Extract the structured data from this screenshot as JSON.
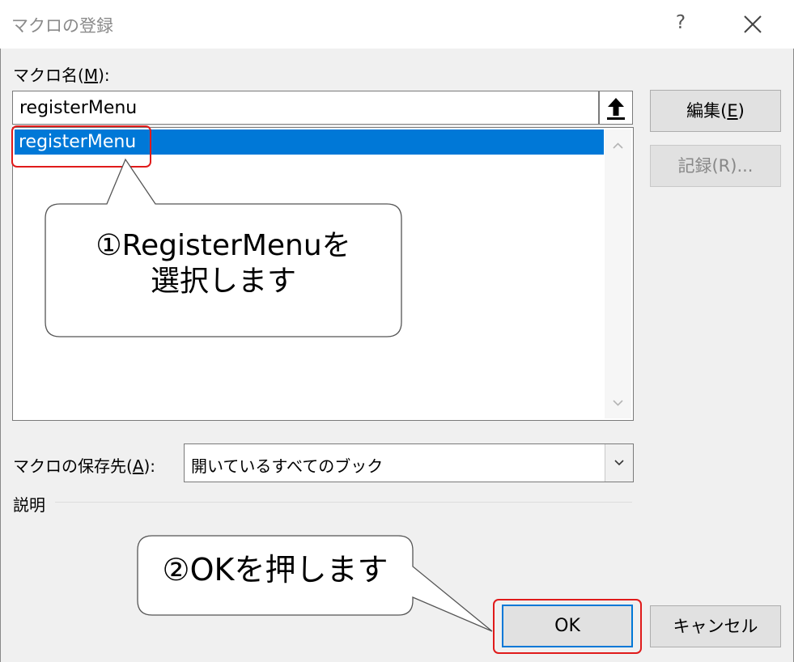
{
  "dialog": {
    "title": "マクロの登録",
    "help_label": "?"
  },
  "macro_name": {
    "label_prefix": "マクロ名(",
    "label_accel": "M",
    "label_suffix": "):",
    "value": "registerMenu"
  },
  "macro_list": {
    "items": [
      {
        "label": "registerMenu",
        "selected": true
      }
    ]
  },
  "buttons": {
    "edit_prefix": "編集(",
    "edit_accel": "E",
    "edit_suffix": ")",
    "record": "記録(R)...",
    "ok": "OK",
    "cancel": "キャンセル"
  },
  "save_in": {
    "label_prefix": "マクロの保存先(",
    "label_accel": "A",
    "label_suffix": "):",
    "value": "開いているすべてのブック"
  },
  "description": {
    "label": "説明"
  },
  "annotations": {
    "callout1_line1": "①RegisterMenuを",
    "callout1_line2": "選択します",
    "callout2": "②OKを押します",
    "highlight_color": "#e01b1b"
  },
  "colors": {
    "selection": "#0078d7",
    "dialog_bg": "#f0f0f0",
    "ok_border": "#0078d7"
  }
}
